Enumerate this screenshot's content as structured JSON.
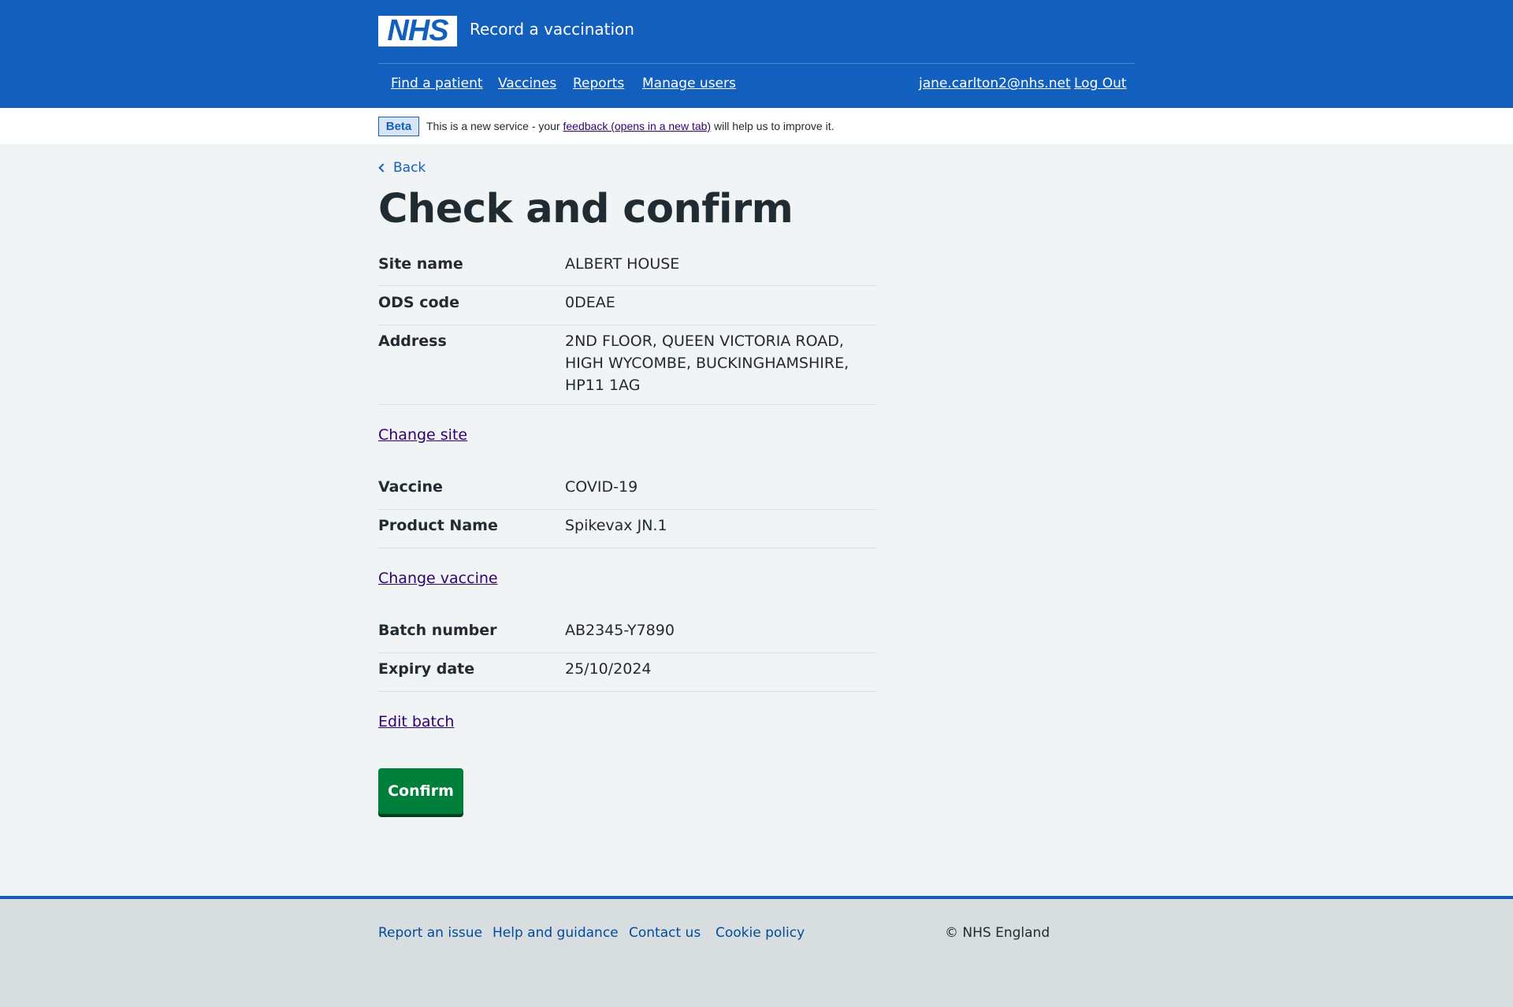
{
  "header": {
    "logo_text": "NHS",
    "service_name": "Record a vaccination",
    "nav": [
      {
        "label": "Find a patient"
      },
      {
        "label": "Vaccines"
      },
      {
        "label": "Reports"
      },
      {
        "label": "Manage users"
      }
    ],
    "user_email": "jane.carlton2@nhs.net",
    "logout_label": "Log Out"
  },
  "beta": {
    "tag": "Beta",
    "text_before": "This is a new service - your ",
    "link_text": "feedback (opens in a new tab)",
    "text_after": " will help us to improve it."
  },
  "main": {
    "back_label": "Back",
    "title": "Check and confirm",
    "site": {
      "rows": [
        {
          "key": "Site name",
          "value": "ALBERT HOUSE"
        },
        {
          "key": "ODS code",
          "value": "0DEAE"
        },
        {
          "key": "Address",
          "value": "2ND FLOOR, QUEEN VICTORIA ROAD, HIGH WYCOMBE, BUCKINGHAMSHIRE, HP11 1AG"
        }
      ],
      "change_label": "Change site"
    },
    "vaccine": {
      "rows": [
        {
          "key": "Vaccine",
          "value": "COVID-19"
        },
        {
          "key": "Product Name",
          "value": "Spikevax JN.1"
        }
      ],
      "change_label": "Change vaccine"
    },
    "batch": {
      "rows": [
        {
          "key": "Batch number",
          "value": "AB2345-Y7890"
        },
        {
          "key": "Expiry date",
          "value": "25/10/2024"
        }
      ],
      "change_label": "Edit batch"
    },
    "confirm_label": "Confirm"
  },
  "footer": {
    "links": [
      {
        "label": "Report an issue"
      },
      {
        "label": "Help and guidance"
      },
      {
        "label": "Contact us"
      },
      {
        "label": "Cookie policy"
      }
    ],
    "copyright": "© NHS England"
  },
  "colors": {
    "brand_blue": "#135fbd",
    "confirm_green": "#007f3b",
    "visited_link": "#330072",
    "page_background": "#f0f4f5",
    "footer_background": "#d8dde0"
  },
  "icons": {
    "back": "chevron-left-icon"
  }
}
